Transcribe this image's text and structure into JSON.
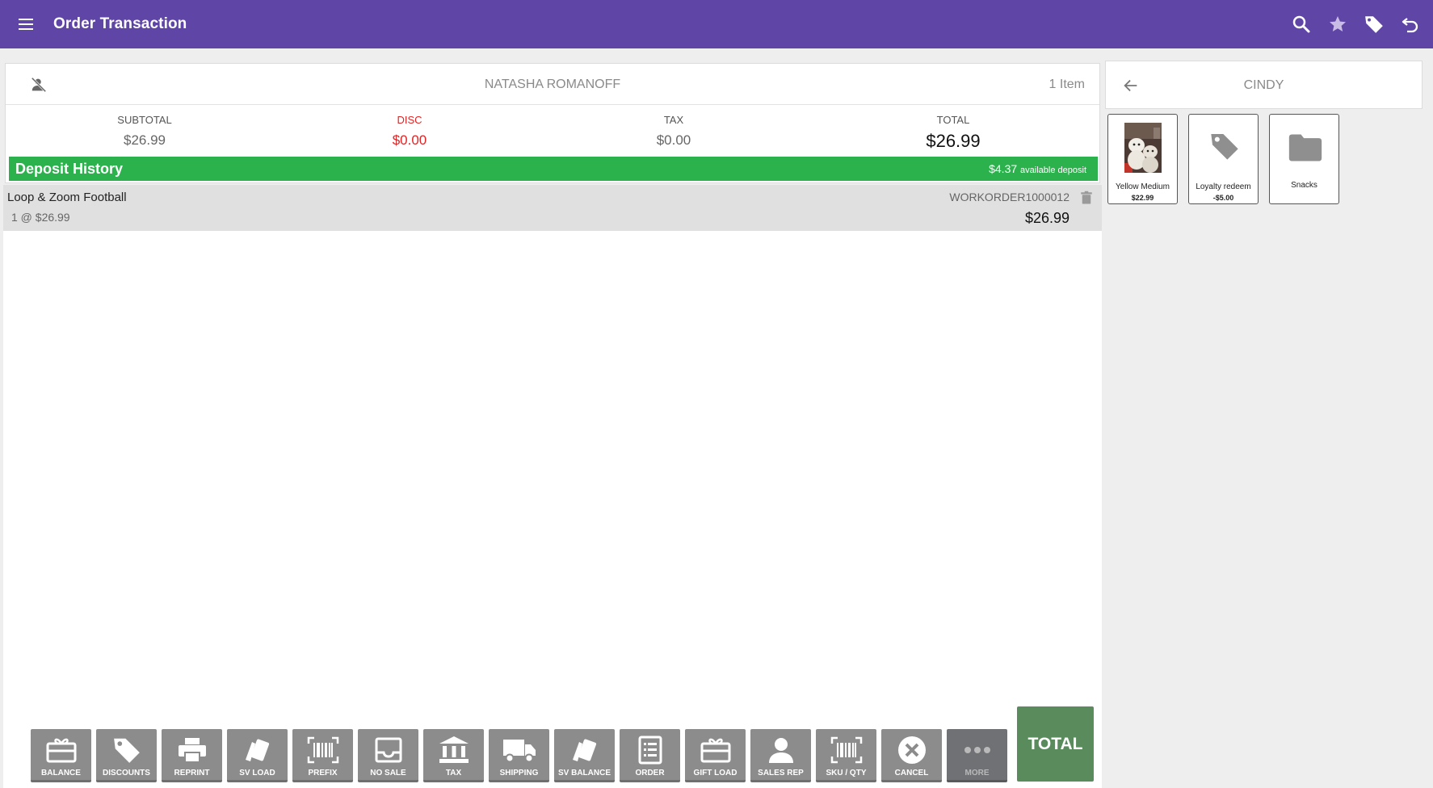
{
  "appbar": {
    "title": "Order Transaction",
    "icons": [
      "menu-icon",
      "search-icon",
      "star-icon",
      "tag-icon",
      "undo-icon"
    ],
    "color": "#5e45a6"
  },
  "customer": {
    "name": "NATASHA ROMANOFF",
    "item_count": "1 Item"
  },
  "totals": {
    "subtotal_label": "SUBTOTAL",
    "subtotal": "$26.99",
    "disc_label": "DISC",
    "disc": "$0.00",
    "tax_label": "TAX",
    "tax": "$0.00",
    "total_label": "TOTAL",
    "total": "$26.99"
  },
  "deposit": {
    "label": "Deposit History",
    "amount": "$4.37",
    "amount_suffix": "available deposit",
    "color": "#2bb24c"
  },
  "line_items": [
    {
      "name": "Loop & Zoom Football",
      "qty_price": "1 @ $26.99",
      "reference": "WORKORDER1000012",
      "price": "$26.99"
    }
  ],
  "category": {
    "title": "CINDY",
    "tiles": [
      {
        "label": "Yellow Medium",
        "price": "$22.99",
        "kind": "photo"
      },
      {
        "label": "Loyalty redeem",
        "price": "-$5.00",
        "kind": "tag-icon"
      },
      {
        "label": "Snacks",
        "price": "",
        "kind": "folder-icon"
      }
    ]
  },
  "toolbar": {
    "buttons": [
      {
        "label": "BALANCE",
        "icon": "gift-card-icon"
      },
      {
        "label": "DISCOUNTS",
        "icon": "tag-icon"
      },
      {
        "label": "REPRINT",
        "icon": "printer-icon"
      },
      {
        "label": "SV LOAD",
        "icon": "cards-icon"
      },
      {
        "label": "PREFIX",
        "icon": "barcode-icon"
      },
      {
        "label": "NO SALE",
        "icon": "drawer-icon"
      },
      {
        "label": "TAX",
        "icon": "bank-icon"
      },
      {
        "label": "SHIPPING",
        "icon": "truck-icon"
      },
      {
        "label": "SV BALANCE",
        "icon": "cards-icon"
      },
      {
        "label": "ORDER",
        "icon": "document-icon"
      },
      {
        "label": "GIFT LOAD",
        "icon": "gift-card-icon"
      },
      {
        "label": "SALES REP",
        "icon": "person-icon"
      },
      {
        "label": "SKU / QTY",
        "icon": "barcode-icon"
      },
      {
        "label": "CANCEL",
        "icon": "cancel-icon"
      },
      {
        "label": "MORE",
        "icon": "more-icon"
      }
    ],
    "total_label": "TOTAL"
  }
}
